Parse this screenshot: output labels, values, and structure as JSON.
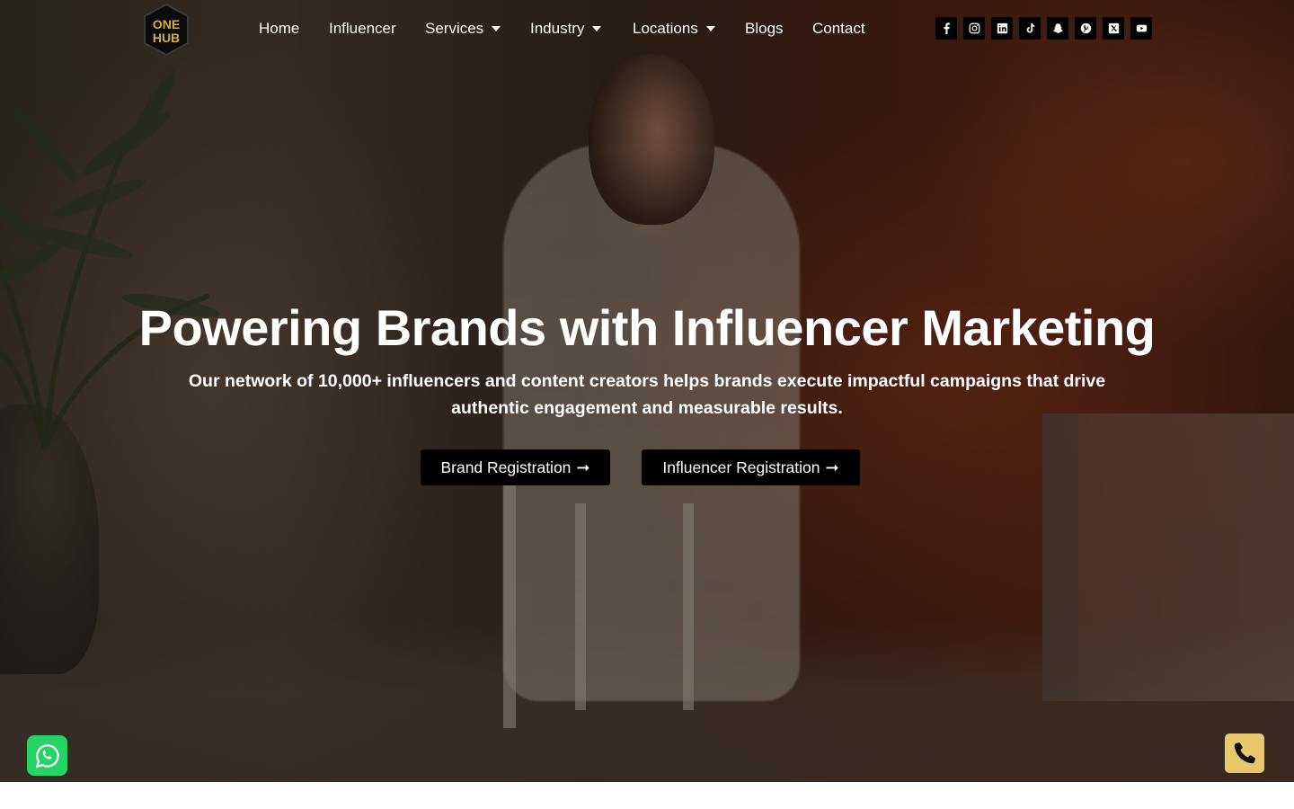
{
  "brand": {
    "logo_lines": [
      "ONE",
      "HUB"
    ],
    "accent_color": "#d4af37",
    "icon": "onehub-hexagon-logo"
  },
  "nav": {
    "items": [
      {
        "label": "Home",
        "has_dropdown": false
      },
      {
        "label": "Influencer",
        "has_dropdown": false
      },
      {
        "label": "Services",
        "has_dropdown": true
      },
      {
        "label": "Industry",
        "has_dropdown": true
      },
      {
        "label": "Locations",
        "has_dropdown": true
      },
      {
        "label": "Blogs",
        "has_dropdown": false
      },
      {
        "label": "Contact",
        "has_dropdown": false
      }
    ]
  },
  "social": [
    {
      "icon": "facebook-icon"
    },
    {
      "icon": "instagram-icon"
    },
    {
      "icon": "linkedin-icon"
    },
    {
      "icon": "tiktok-icon"
    },
    {
      "icon": "snapchat-icon"
    },
    {
      "icon": "pinterest-icon"
    },
    {
      "icon": "x-twitter-icon"
    },
    {
      "icon": "youtube-icon"
    }
  ],
  "hero": {
    "headline": "Powering Brands with Influencer Marketing",
    "subtext": "Our network of 10,000+ influencers and content creators helps brands execute impactful campaigns that drive authentic engagement and measurable results.",
    "buttons": {
      "brand_registration": "Brand Registration",
      "influencer_registration": "Influencer Registration"
    }
  },
  "floating": {
    "whatsapp_icon": "whatsapp-icon",
    "whatsapp_color": "#25d366",
    "phone_icon": "phone-icon",
    "phone_color": "#e9c76d"
  }
}
